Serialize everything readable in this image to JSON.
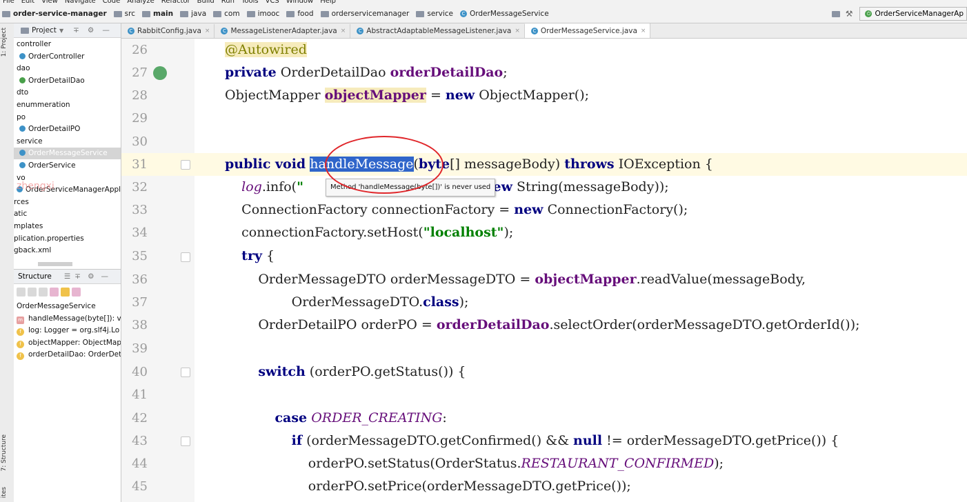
{
  "menubar": {
    "items": [
      "File",
      "Edit",
      "View",
      "Navigate",
      "Code",
      "Analyze",
      "Refactor",
      "Build",
      "Run",
      "Tools",
      "VCS",
      "Window",
      "Help"
    ]
  },
  "breadcrumb": {
    "project": "order-service-manager",
    "path": [
      "src",
      "main",
      "java",
      "com",
      "imooc",
      "food",
      "orderservicemanager",
      "service"
    ],
    "file": "OrderMessageService"
  },
  "run_config": {
    "label": "OrderServiceManagerAp"
  },
  "sidebar_strip": {
    "project_tab": "1: Project",
    "structure_tab": "7: Structure",
    "bottom_tab": "ites"
  },
  "project_panel": {
    "title": "Project",
    "tree": [
      {
        "label": "controller",
        "type": "folder"
      },
      {
        "label": "OrderController",
        "type": "class"
      },
      {
        "label": "dao",
        "type": "folder"
      },
      {
        "label": "OrderDetailDao",
        "type": "interface"
      },
      {
        "label": "dto",
        "type": "folder"
      },
      {
        "label": "enummeration",
        "type": "folder"
      },
      {
        "label": "po",
        "type": "folder"
      },
      {
        "label": "OrderDetailPO",
        "type": "class"
      },
      {
        "label": "service",
        "type": "folder"
      },
      {
        "label": "OrderMessageService",
        "type": "class"
      },
      {
        "label": "OrderService",
        "type": "class"
      },
      {
        "label": "vo",
        "type": "folder"
      },
      {
        "label": "OrderServiceManagerApplicati",
        "type": "class"
      },
      {
        "label": "rces",
        "type": "folder"
      },
      {
        "label": "atic",
        "type": "folder"
      },
      {
        "label": "mplates",
        "type": "folder"
      },
      {
        "label": "plication.properties",
        "type": "file"
      },
      {
        "label": "gback.xml",
        "type": "file"
      }
    ]
  },
  "structure_panel": {
    "title": "Structure",
    "root": "OrderMessageService",
    "items": [
      {
        "badge": "m",
        "label": "handleMessage(byte[]): vo"
      },
      {
        "badge": "f",
        "label": "log: Logger = org.slf4j.Lo"
      },
      {
        "badge": "f",
        "label": "objectMapper: ObjectMap"
      },
      {
        "badge": "f",
        "label": "orderDetailDao: OrderDet"
      }
    ]
  },
  "tabs": [
    {
      "label": "RabbitConfig.java"
    },
    {
      "label": "MessageListenerAdapter.java"
    },
    {
      "label": "AbstractAdaptableMessageListener.java"
    },
    {
      "label": "OrderMessageService.java",
      "active": true
    }
  ],
  "editor": {
    "line_numbers": [
      "26",
      "27",
      "28",
      "29",
      "30",
      "31",
      "32",
      "33",
      "34",
      "35",
      "36",
      "37",
      "38",
      "39",
      "40",
      "41",
      "42",
      "43",
      "44",
      "45"
    ],
    "tooltip": "Method 'handleMessage(byte[])' is never used",
    "watermark": "zhengxi"
  },
  "colors": {
    "keyword": "#000080",
    "annotation": "#808000",
    "field": "#660e7a",
    "string": "#008000",
    "selection": "#2f65ca",
    "annotation_circle": "#e0262a"
  }
}
